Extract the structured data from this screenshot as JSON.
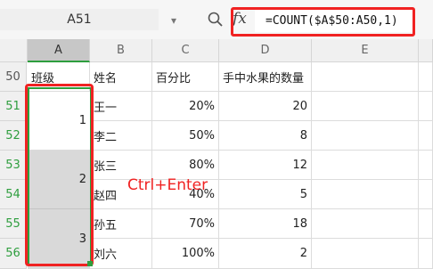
{
  "formula_bar": {
    "cell_ref": "A51",
    "dropdown_icon": "chevron-down-icon",
    "zoom_icon": "magnifier-icon",
    "fx_label": "fx",
    "formula": "=COUNT($A$50:A50,1)"
  },
  "columns": [
    "A",
    "B",
    "C",
    "D",
    "E"
  ],
  "rows": [
    "50",
    "51",
    "52",
    "53",
    "54",
    "55",
    "56"
  ],
  "headers": {
    "a": "班级",
    "b": "姓名",
    "c": "百分比",
    "d": "手中水果的数量"
  },
  "records": [
    {
      "name": "王一",
      "pct": "20%",
      "qty": "20"
    },
    {
      "name": "李二",
      "pct": "50%",
      "qty": "8"
    },
    {
      "name": "张三",
      "pct": "80%",
      "qty": "12"
    },
    {
      "name": "赵四",
      "pct": "40%",
      "qty": "5"
    },
    {
      "name": "孙五",
      "pct": "70%",
      "qty": "18"
    },
    {
      "name": "刘六",
      "pct": "100%",
      "qty": "2"
    }
  ],
  "merged_a": [
    "1",
    "2",
    "3"
  ],
  "annotation": "Ctrl+Enter",
  "colors": {
    "highlight_red": "#f02222",
    "selection_green": "#2e9e3e",
    "selected_fill": "#d9d9d9"
  }
}
